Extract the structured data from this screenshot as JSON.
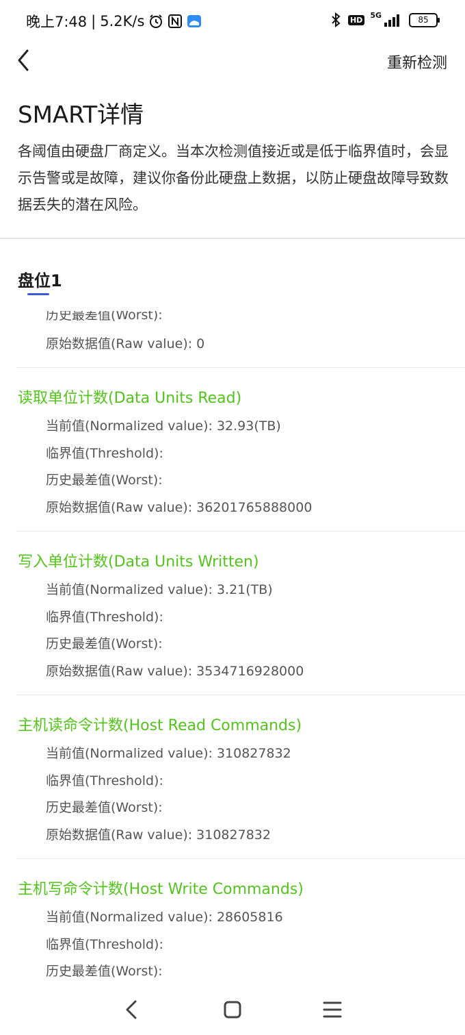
{
  "status_bar": {
    "time": "晚上7:48",
    "speed": "5.2K/s",
    "network": "5G",
    "hd_label": "HD",
    "battery": "85"
  },
  "header": {
    "recheck_label": "重新检测",
    "title": "SMART详情",
    "description": "各阈值由硬盘厂商定义。当本次检测值接近或是低于临界值时，会显示告警或是故障，建议你备份此硬盘上数据，以防止硬盘故障导致数据丢失的潜在风险。"
  },
  "tab": {
    "label": "盘位1"
  },
  "partial_top": {
    "worst": "历史最差值(Worst):",
    "raw": "原始数据值(Raw value): 0"
  },
  "sections": [
    {
      "title": "读取单位计数(Data Units Read)",
      "current": "当前值(Normalized value): 32.93(TB)",
      "threshold": "临界值(Threshold):",
      "worst": "历史最差值(Worst):",
      "raw": "原始数据值(Raw value): 36201765888000"
    },
    {
      "title": "写入单位计数(Data Units Written)",
      "current": "当前值(Normalized value): 3.21(TB)",
      "threshold": "临界值(Threshold):",
      "worst": "历史最差值(Worst):",
      "raw": "原始数据值(Raw value): 3534716928000"
    },
    {
      "title": "主机读命令计数(Host Read Commands)",
      "current": "当前值(Normalized value): 310827832",
      "threshold": "临界值(Threshold):",
      "worst": "历史最差值(Worst):",
      "raw": "原始数据值(Raw value): 310827832"
    },
    {
      "title": "主机写命令计数(Host Write Commands)",
      "current": "当前值(Normalized value): 28605816",
      "threshold": "临界值(Threshold):",
      "worst": "历史最差值(Worst):"
    }
  ],
  "colors": {
    "section_title": "#52c41a",
    "tab_indicator": "#3a5bd9",
    "divider": "#e3e3e3"
  },
  "icons": [
    "alarm-icon",
    "nfc-icon",
    "app-icon",
    "bluetooth-icon",
    "signal-icon",
    "battery-icon",
    "back-icon",
    "nav-back-icon",
    "nav-home-icon",
    "nav-menu-icon"
  ]
}
